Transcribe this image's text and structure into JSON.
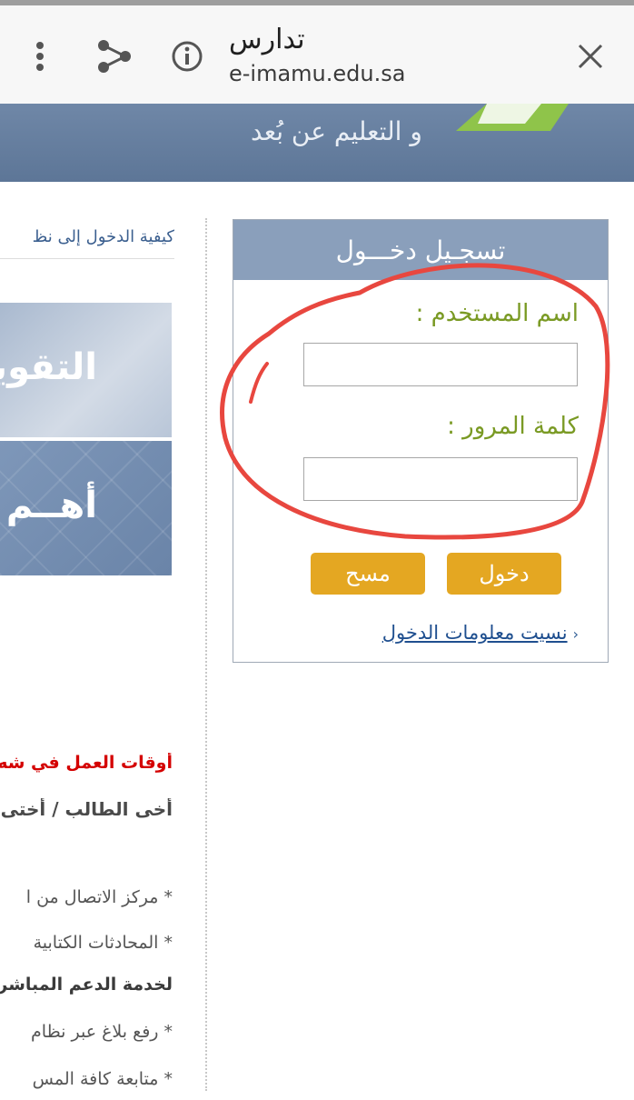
{
  "browser": {
    "title": "تدارس",
    "url": "e-imamu.edu.sa",
    "icons": [
      "more-vert-icon",
      "share-icon",
      "info-icon",
      "close-icon"
    ]
  },
  "banner": {
    "tagline": "و التعليم عن بُعد"
  },
  "left": {
    "howto": "كيفية الدخول إلى نظ",
    "promo1": "التقويم",
    "promo2": "أهــم",
    "hours_title": "أوقات العمل في شه",
    "greeting": "أخى الطالب / أختى",
    "line1": "* مركز الاتصال من ا",
    "line2": "* المحادثات الكتابية",
    "line3": "لخدمة الدعم المباشر",
    "line4": "* رفع بلاغ عبر نظام",
    "line5": "* متابعة كافة المس"
  },
  "login": {
    "header": "تسجـيل دخـــول",
    "username_label": "اسم المستخدم :",
    "username_value": "",
    "password_label": "كلمة المرور :",
    "password_value": "",
    "login_button": "دخول",
    "clear_button": "مسح",
    "forgot_link": "نسيت معلومات الدخول"
  },
  "colors": {
    "banner": "#6f87a7",
    "login_header": "#8a9fbb",
    "label_green": "#7a9a24",
    "button_gold": "#e4a722",
    "annotation_red": "#e8473f",
    "alert_red": "#d40000"
  }
}
